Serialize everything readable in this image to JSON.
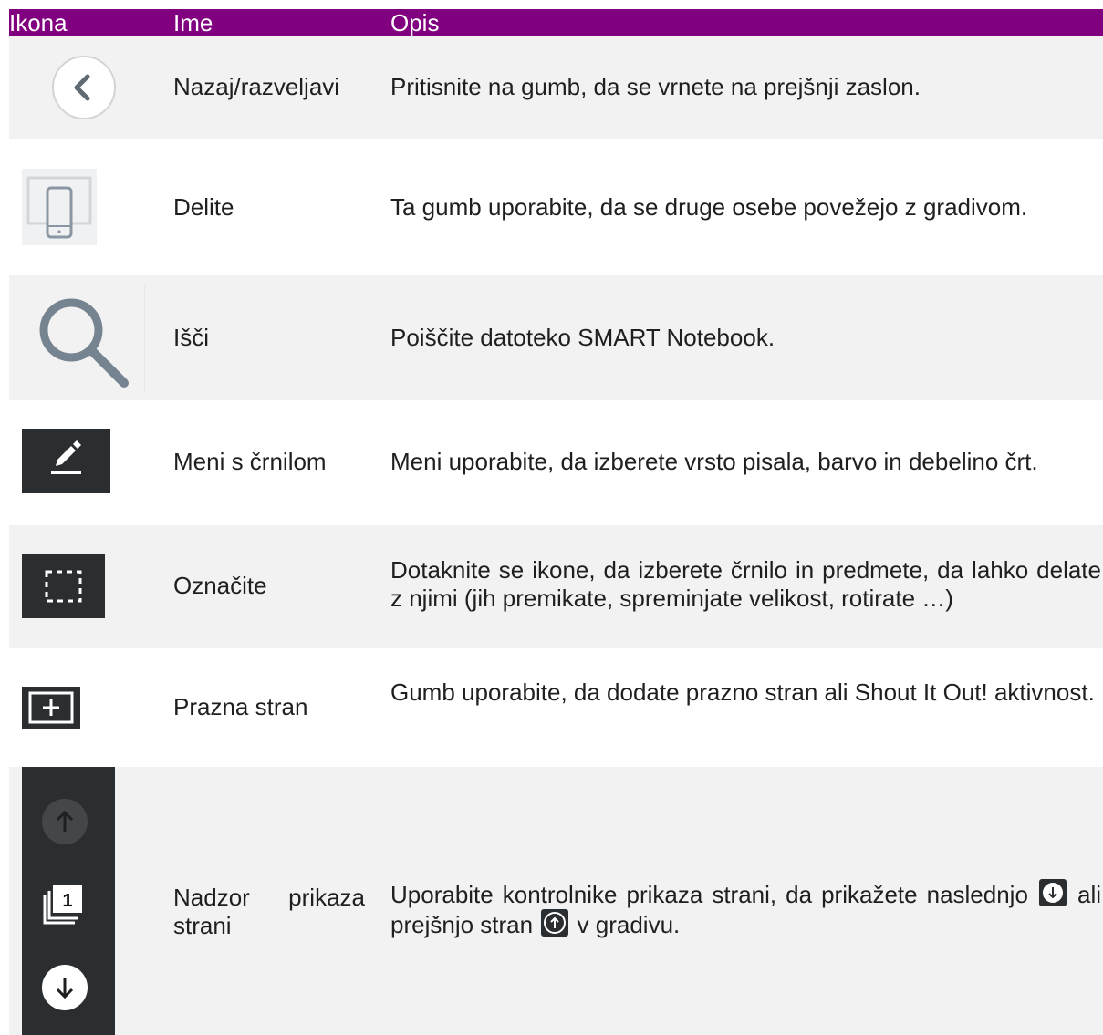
{
  "header": {
    "col_icon": "Ikona",
    "col_name": "Ime",
    "col_desc": "Opis"
  },
  "rows": [
    {
      "icon": "back-undo-icon",
      "name": "Nazaj/razveljavi",
      "desc": "Pritisnite na gumb, da se vrnete na prejšnji zaslon."
    },
    {
      "icon": "share-device-icon",
      "name": "Delite",
      "desc": "Ta gumb uporabite, da se druge osebe povežejo z gradivom."
    },
    {
      "icon": "search-icon",
      "name": "Išči",
      "desc": "Poiščite datoteko SMART Notebook."
    },
    {
      "icon": "pen-ink-icon",
      "name": "Meni s črnilom",
      "desc": "Meni uporabite, da izberete vrsto pisala, barvo in debelino črt."
    },
    {
      "icon": "select-dashed-rect-icon",
      "name": "Označite",
      "desc": "Dotaknite se ikone, da izberete črnilo in predmete, da lahko delate z njimi (jih premikate, spreminjate velikost, rotirate …)"
    },
    {
      "icon": "add-page-icon",
      "name": "Prazna stran",
      "desc": "Gumb uporabite, da dodate prazno stran ali Shout It Out! aktivnost."
    },
    {
      "icon": "page-navigation-icon",
      "name": "Nadzor prikaza strani",
      "desc_part1": "Uporabite kontrolnike prikaza strani, da prikažete naslednjo",
      "desc_part2": "ali prejšnjo stran",
      "desc_part3": "v gradivu.",
      "page_number": "1"
    }
  ],
  "colors": {
    "header_bg": "#800080",
    "row_shade": "#f2f2f2",
    "dark_icon_bg": "#2b2e31"
  }
}
